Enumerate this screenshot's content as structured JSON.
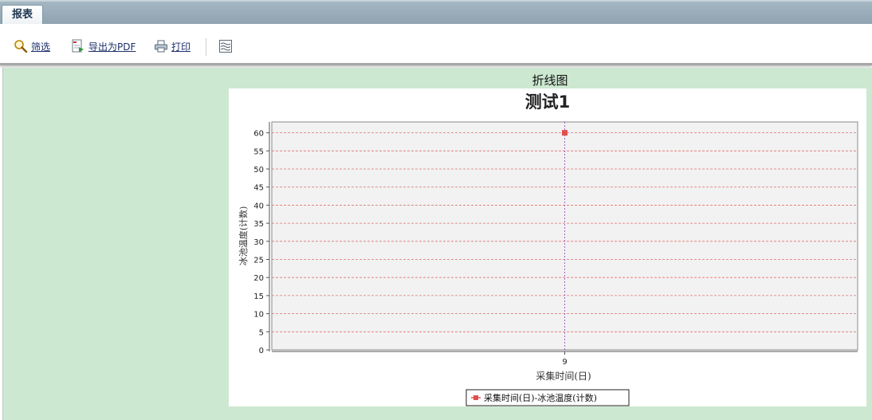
{
  "tabs": [
    {
      "label": "报表"
    }
  ],
  "toolbar": {
    "filter_label": "筛选",
    "export_pdf_label": "导出为PDF",
    "print_label": "打印"
  },
  "chart_caption": "折线图",
  "chart_data": {
    "type": "line",
    "title": "测试1",
    "xlabel": "采集时间(日)",
    "ylabel": "冰池温度(计数)",
    "categories": [
      "9"
    ],
    "series": [
      {
        "name": "采集时间(日)-冰池温度(计数)",
        "values": [
          60
        ],
        "color": "#e05050"
      }
    ],
    "ylim": [
      0,
      63
    ],
    "yticks": [
      0,
      5,
      10,
      15,
      20,
      25,
      30,
      35,
      40,
      45,
      50,
      55,
      60
    ],
    "grid": true,
    "legend_position": "bottom"
  }
}
